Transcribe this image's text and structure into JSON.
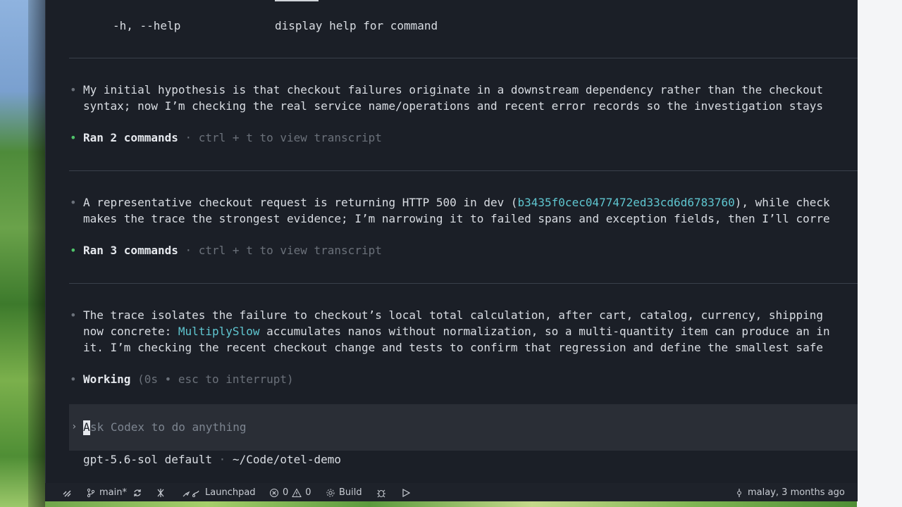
{
  "help_line": {
    "flag": "-h, --help",
    "description": "display help for command"
  },
  "messages": [
    {
      "bullet": "•",
      "lines": [
        "My initial hypothesis is that checkout failures originate in a downstream dependency rather than the checkout",
        "syntax; now I’m checking the real service name/operations and recent error records so the investigation stays"
      ]
    },
    {
      "bullet": "•",
      "line1_before": "A representative checkout request is returning HTTP 500 in dev (",
      "trace_id": "b3435f0cec0477472ed33cd6d6783760",
      "line1_after": "), while check",
      "line2": "makes the trace the strongest evidence; I’m narrowing it to failed spans and exception fields, then I’ll corre"
    },
    {
      "bullet": "•",
      "line1": "The trace isolates the failure to checkout’s local total calculation, after cart, catalog, currency, shipping",
      "line2_before": "now concrete: ",
      "function_name": "MultiplySlow",
      "line2_after": " accumulates nanos without normalization, so a multi-quantity item can produce an in",
      "line3": "it. I’m checking the recent checkout change and tests to confirm that regression and define the smallest safe"
    }
  ],
  "ran_blocks": [
    {
      "bullet": "•",
      "label": "Ran 2 commands",
      "hint": " · ctrl + t to view transcript"
    },
    {
      "bullet": "•",
      "label": "Ran 3 commands",
      "hint": " · ctrl + t to view transcript"
    }
  ],
  "working": {
    "bullet": "•",
    "label": "Working",
    "detail": " (0s • esc to interrupt)"
  },
  "composer": {
    "chevron": "›",
    "placeholder_first": "A",
    "placeholder_rest": "sk Codex to do anything"
  },
  "footer": {
    "model": "gpt-5.6-sol default",
    "separator": " · ",
    "path": "~/Code/otel-demo"
  },
  "statusbar": {
    "branch": "main*",
    "launchpad": "Launchpad",
    "errors": "0",
    "warnings": "0",
    "build": "Build",
    "blame": "malay, 3 months ago"
  },
  "colors": {
    "background": "#1b1f27",
    "accent_green": "#4fc36a",
    "accent_cyan": "#5fc6d0",
    "muted": "#7d8590"
  }
}
